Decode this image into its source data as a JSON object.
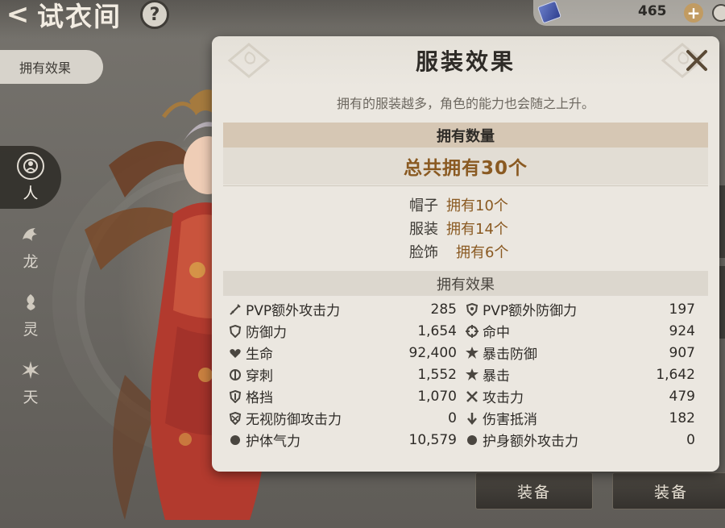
{
  "header": {
    "back_glyph": "<",
    "title": "试衣间",
    "help_glyph": "?"
  },
  "currency": {
    "icon": "crystal-icon",
    "amount": "465",
    "plus_glyph": "+"
  },
  "sidebar": {
    "effect_tab": "拥有效果",
    "categories": [
      {
        "label": "人",
        "icon": "person-emblem-icon",
        "active": true
      },
      {
        "label": "龙",
        "icon": "dragon-emblem-icon",
        "active": false
      },
      {
        "label": "灵",
        "icon": "spirit-emblem-icon",
        "active": false
      },
      {
        "label": "天",
        "icon": "heaven-emblem-icon",
        "active": false
      }
    ]
  },
  "equip_buttons": [
    "装备",
    "装备"
  ],
  "dialog": {
    "title": "服装效果",
    "subtitle": "拥有的服装越多，角色的能力也会随之上升。",
    "owned_header": "拥有数量",
    "total": "总共拥有30个",
    "counts": [
      {
        "name": "帽子",
        "value": "拥有10个"
      },
      {
        "name": "服装",
        "value": "拥有14个"
      },
      {
        "name": "脸饰",
        "value": "拥有6个"
      }
    ],
    "effects_header": "拥有效果",
    "stats_left": [
      {
        "icon": "sword-icon",
        "name": "PVP额外攻击力",
        "value": "285"
      },
      {
        "icon": "shield-icon",
        "name": "防御力",
        "value": "1,654"
      },
      {
        "icon": "heart-icon",
        "name": "生命",
        "value": "92,400"
      },
      {
        "icon": "pierce-icon",
        "name": "穿刺",
        "value": "1,552"
      },
      {
        "icon": "block-shield-icon",
        "name": "格挡",
        "value": "1,070"
      },
      {
        "icon": "ignore-defense-icon",
        "name": "无视防御攻击力",
        "value": "0"
      },
      {
        "icon": "guard-icon",
        "name": "护体气力",
        "value": "10,579"
      }
    ],
    "stats_right": [
      {
        "icon": "pvp-shield-icon",
        "name": "PVP额外防御力",
        "value": "197"
      },
      {
        "icon": "crosshair-icon",
        "name": "命中",
        "value": "924"
      },
      {
        "icon": "critical-defense-icon",
        "name": "暴击防御",
        "value": "907"
      },
      {
        "icon": "critical-icon",
        "name": "暴击",
        "value": "1,642"
      },
      {
        "icon": "crossed-swords-icon",
        "name": "攻击力",
        "value": "479"
      },
      {
        "icon": "down-arrow-icon",
        "name": "伤害抵消",
        "value": "182"
      },
      {
        "icon": "guard-attack-icon",
        "name": "护身额外攻击力",
        "value": "0"
      }
    ]
  },
  "colors": {
    "accent_brown": "#8a5a22",
    "dialog_bg": "#ebe7e0",
    "owned_header_bg": "#d6c7b4"
  }
}
